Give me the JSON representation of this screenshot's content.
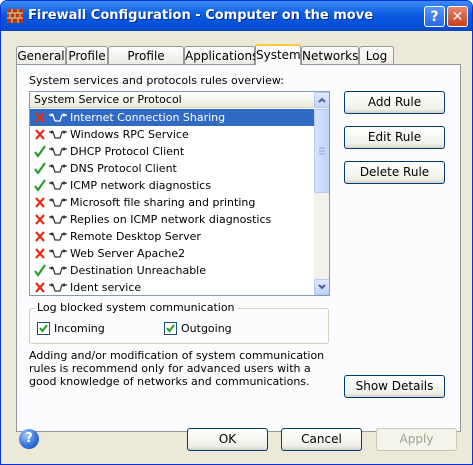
{
  "window": {
    "title": "Firewall Configuration - Computer on the move",
    "help_button": "?",
    "close_button": "✕"
  },
  "tabs": [
    {
      "label": "General"
    },
    {
      "label": "Profile"
    },
    {
      "label": "Profile switch"
    },
    {
      "label": "Applications"
    },
    {
      "label": "System"
    },
    {
      "label": "Networks"
    },
    {
      "label": "Log"
    }
  ],
  "active_tab": "System",
  "system": {
    "overview_label": "System services and protocols rules overview:",
    "list_header": "System Service or Protocol",
    "rules": [
      {
        "name": "Internet Connection Sharing",
        "status": "blocked",
        "selected": true
      },
      {
        "name": "Windows RPC Service",
        "status": "blocked"
      },
      {
        "name": "DHCP Protocol Client",
        "status": "allowed"
      },
      {
        "name": "DNS Protocol Client",
        "status": "allowed"
      },
      {
        "name": "ICMP network diagnostics",
        "status": "allowed"
      },
      {
        "name": "Microsoft file sharing and printing",
        "status": "blocked"
      },
      {
        "name": "Replies on ICMP network diagnostics",
        "status": "blocked"
      },
      {
        "name": "Remote Desktop Server",
        "status": "blocked"
      },
      {
        "name": "Web Server Apache2",
        "status": "blocked"
      },
      {
        "name": "Destination Unreachable",
        "status": "allowed"
      },
      {
        "name": "Ident service",
        "status": "blocked"
      }
    ],
    "buttons": {
      "add_rule": "Add Rule",
      "edit_rule": "Edit Rule",
      "delete_rule": "Delete Rule",
      "show_details": "Show Details"
    },
    "log_group": {
      "title": "Log blocked system communication",
      "incoming": {
        "label": "Incoming",
        "checked": true
      },
      "outgoing": {
        "label": "Outgoing",
        "checked": true
      }
    },
    "info_text": "Adding and/or modification of system communication rules is recommend only for advanced users with a good knowledge of networks and communications."
  },
  "footer": {
    "ok": "OK",
    "cancel": "Cancel",
    "apply": "Apply"
  },
  "colors": {
    "titlebar": "#0a5ce1",
    "selection": "#316ac5",
    "blocked": "#e02a16",
    "allowed": "#1f9a1f",
    "window_bg": "#ece9d8"
  }
}
